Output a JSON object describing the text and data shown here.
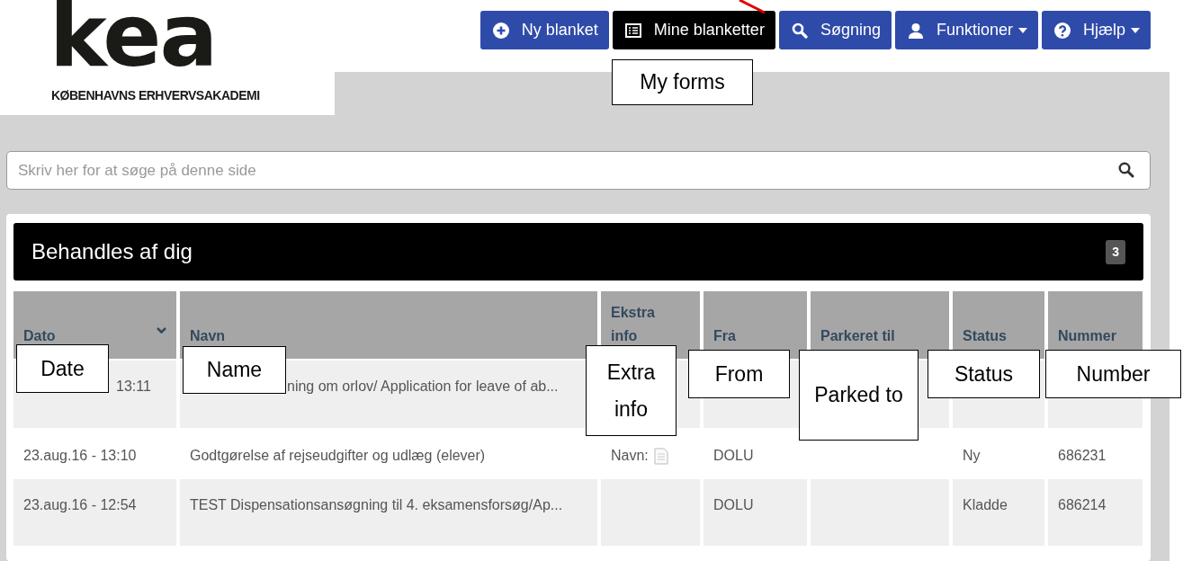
{
  "logo": {
    "mark": "kea",
    "subtitle": "KØBENHAVNS ERHVERVSAKADEMI"
  },
  "nav": [
    {
      "label": "Ny blanket",
      "caret": false,
      "selected": false
    },
    {
      "label": "Mine blanketter",
      "caret": false,
      "selected": true
    },
    {
      "label": "Søgning",
      "caret": false,
      "selected": false
    },
    {
      "label": "Funktioner",
      "caret": true,
      "selected": false
    },
    {
      "label": "Hjælp",
      "caret": true,
      "selected": false
    }
  ],
  "search": {
    "placeholder": "Skriv her for at søge på denne side"
  },
  "panel": {
    "title": "Behandles af dig",
    "count": "3"
  },
  "table": {
    "columns": [
      {
        "label": "Dato",
        "sorted": true
      },
      {
        "label": "Navn",
        "sorted": false
      },
      {
        "label": "Ekstra info",
        "sorted": false
      },
      {
        "label": "Fra",
        "sorted": false
      },
      {
        "label": "Parkeret til",
        "sorted": false
      },
      {
        "label": "Status",
        "sorted": false
      },
      {
        "label": "Nummer",
        "sorted": false
      }
    ],
    "rows": [
      {
        "cells": [
          "13:11",
          "ning om orlov/ Application for leave of ab...",
          "",
          "",
          "",
          "",
          ""
        ],
        "extra_icon": false
      },
      {
        "cells": [
          "23.aug.16 - 13:10",
          "Godtgørelse af rejseudgifter og udlæg (elever)",
          "Navn:",
          "DOLU",
          "",
          "Ny",
          "686231"
        ],
        "extra_icon": true
      },
      {
        "cells": [
          "23.aug.16 - 12:54",
          "TEST Dispensationsansøgning til 4. eksamensforsøg/Ap...",
          "",
          "DOLU",
          "",
          "Kladde",
          "686214"
        ],
        "extra_icon": false
      }
    ]
  },
  "callouts": [
    {
      "text": "My forms"
    },
    {
      "text": "Date"
    },
    {
      "text": "Name"
    },
    {
      "text": "Extra info"
    },
    {
      "text": "From"
    },
    {
      "text": "Parked to"
    },
    {
      "text": "Status"
    },
    {
      "text": "Number"
    }
  ]
}
